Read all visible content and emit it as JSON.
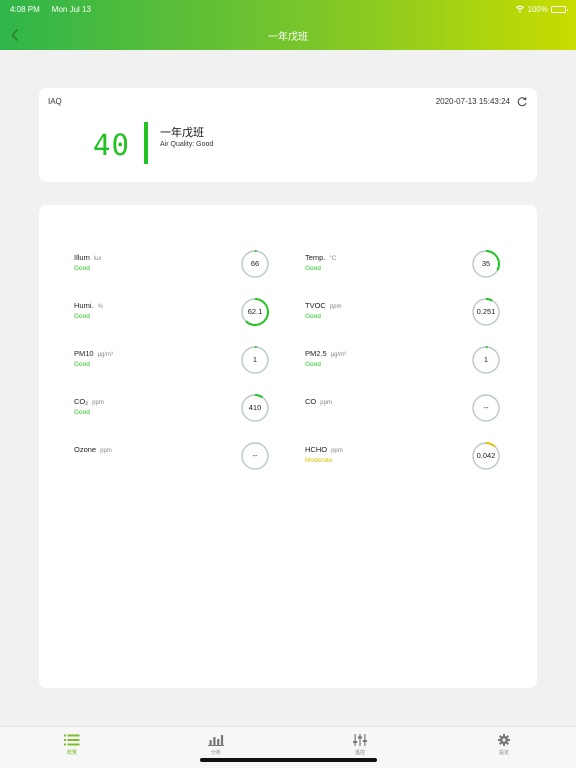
{
  "status_bar": {
    "time": "4:08 PM",
    "date": "Mon Jul 13",
    "battery": "100%"
  },
  "nav": {
    "title": "一年戊班"
  },
  "summary": {
    "label": "IAQ",
    "timestamp": "2020-07-13 15:43:24",
    "aqi": "40",
    "room": "一年戊班",
    "status": "Air Quality: Good",
    "accent_color": "#23c323"
  },
  "metrics": [
    {
      "name": "Illum",
      "unit": "lux",
      "status": "Good",
      "value": "66",
      "level": 0.02,
      "color": "#23c323"
    },
    {
      "name": "Temp.",
      "unit": "°C",
      "status": "Good",
      "value": "35",
      "level": 0.33,
      "color": "#23c323"
    },
    {
      "name": "Humi.",
      "unit": "%",
      "status": "Good",
      "value": "62.1",
      "level": 0.62,
      "color": "#23c323"
    },
    {
      "name": "TVOC",
      "unit": "ppm",
      "status": "Good",
      "value": "0.251",
      "level": 0.08,
      "color": "#23c323"
    },
    {
      "name": "PM10",
      "unit": "μg/m³",
      "status": "Good",
      "value": "1",
      "level": 0.02,
      "color": "#23c323"
    },
    {
      "name": "PM2.5",
      "unit": "μg/m³",
      "status": "Good",
      "value": "1",
      "level": 0.02,
      "color": "#23c323"
    },
    {
      "name": "CO₂",
      "unit": "ppm",
      "status": "Good",
      "value": "410",
      "level": 0.1,
      "color": "#23c323"
    },
    {
      "name": "CO",
      "unit": "ppm",
      "status": "",
      "value": "--",
      "level": 0,
      "color": "#23c323"
    },
    {
      "name": "Ozone",
      "unit": "ppm",
      "status": "",
      "value": "--",
      "level": 0,
      "color": "#23c323"
    },
    {
      "name": "HCHO",
      "unit": "ppm",
      "status": "Moderate",
      "value": "0.042",
      "level": 0.12,
      "color": "#d8c400"
    }
  ],
  "tabs": [
    {
      "label": "概覽",
      "icon": "list-icon",
      "active": true
    },
    {
      "label": "分析",
      "icon": "bar-chart-icon",
      "active": false
    },
    {
      "label": "遙控",
      "icon": "sliders-icon",
      "active": false
    },
    {
      "label": "設定",
      "icon": "gear-icon",
      "active": false
    }
  ],
  "colors": {
    "header_start": "#2fb54a",
    "header_end": "#c8dc00",
    "good": "#23c323",
    "moderate": "#d8c400",
    "tab_active": "#7cbe2a"
  }
}
